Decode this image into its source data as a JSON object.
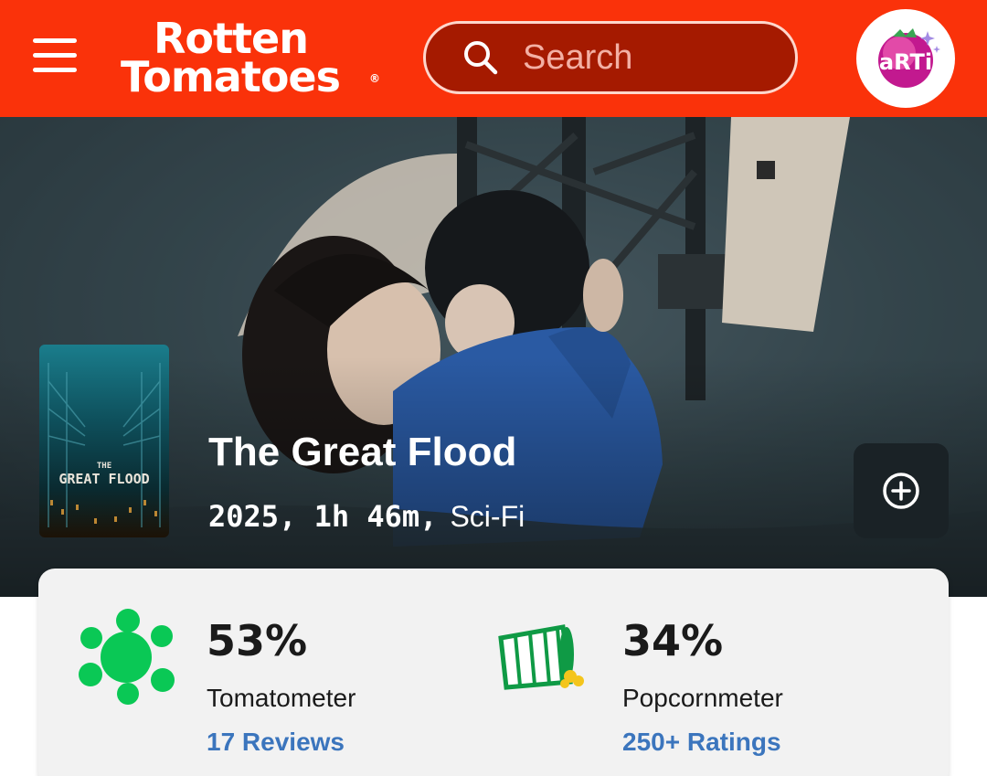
{
  "header": {
    "brand_line1": "Rotten",
    "brand_line2": "Tomatoes",
    "brand_reg": "®",
    "search_placeholder": "Search",
    "avatar_text": "aRTi"
  },
  "movie": {
    "poster_title_small": "THE",
    "poster_title": "GREAT FLOOD",
    "title": "The Great Flood",
    "year_runtime": "2025, 1h 46m,",
    "genre": "Sci-Fi"
  },
  "scores": {
    "tomatometer": {
      "percent": "53%",
      "label": "Tomatometer",
      "reviews_link": "17 Reviews"
    },
    "popcornmeter": {
      "percent": "34%",
      "label": "Popcornmeter",
      "ratings_link": "250+ Ratings"
    }
  },
  "colors": {
    "brand": "#fa320a",
    "search_bg": "#a51a00",
    "link": "#3b75bd",
    "splat_green": "#0ac855",
    "card_bg": "#f2f2f2"
  }
}
